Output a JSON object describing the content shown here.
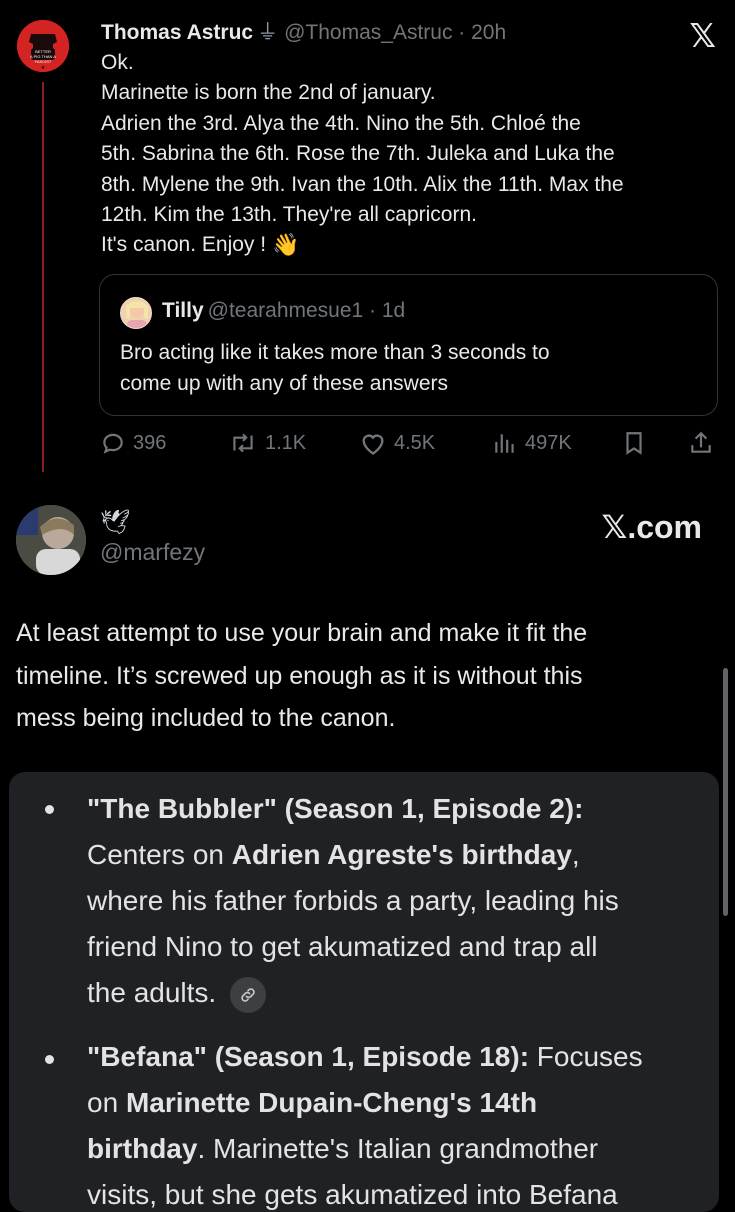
{
  "top_tweet": {
    "author_name": "Thomas Astruc",
    "author_glyph": "⏚",
    "handle_time": "@Thomas_Astruc · 20h",
    "avatar_text": "BETTER A PIG THAN A FASCIST",
    "x_logo": "𝕏",
    "text": "Ok.\nMarinette is born the 2nd of january.\nAdrien the 3rd. Alya the 4th. Nino the 5th. Chloé the\n5th. Sabrina the 6th. Rose the 7th. Juleka and Luka the\n8th. Mylene the 9th. Ivan the 10th. Alix the 11th. Max the\n12th. Kim the 13th. They're all capricorn.\nIt's canon. Enjoy !",
    "emoji": "👋",
    "quote": {
      "author_name": "Tilly",
      "handle_time": "@tearahmesue1 · 1d",
      "text": "Bro acting like it takes more than 3 seconds to\ncome up with any of these answers"
    },
    "actions": {
      "replies": "396",
      "reposts": "1.1K",
      "likes": "4.5K",
      "views": "497K"
    }
  },
  "second_post": {
    "display_emoji": "🕊",
    "handle": "@marfezy",
    "brand": {
      "x": "𝕏",
      "dotcom": ".com"
    },
    "text": "At least attempt to use your brain and make it fit the\ntimeline. It’s screwed up enough as it is without this\nmess being included to the canon."
  },
  "ai_card": {
    "items": [
      {
        "title": "\"The Bubbler\" (Season 1, Episode 2):",
        "line2_a": "Centers on ",
        "line2_b": "Adrien Agreste's birthday",
        "line2_c": ",",
        "rest": "where his father forbids a party, leading his\nfriend Nino to get akumatized and trap all\nthe adults."
      },
      {
        "title": "\"Befana\" (Season 1, Episode 18):",
        "title_tail": " Focuses",
        "line2_a": "on ",
        "line2_b": "Marinette Dupain-Cheng's 14th",
        "line3_b": "birthday",
        "line3_c": ". Marinette's Italian grandmother",
        "line4": "visits, but she gets akumatized into Befana"
      }
    ]
  },
  "colors": {
    "background": "#000000",
    "text": "#e7e9ea",
    "muted": "#71767b",
    "card_bg": "#202124",
    "thread_line": "#8a1e22"
  }
}
